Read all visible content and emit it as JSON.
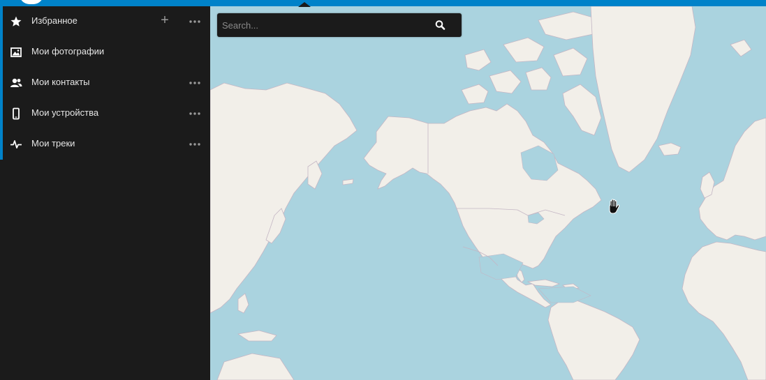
{
  "sidebar": {
    "items": [
      {
        "label": "Избранное",
        "icon": "star-icon",
        "has_add": true,
        "has_menu": true
      },
      {
        "label": "Мои фотографии",
        "icon": "image-icon",
        "has_add": false,
        "has_menu": false
      },
      {
        "label": "Мои контакты",
        "icon": "contacts-icon",
        "has_add": false,
        "has_menu": true
      },
      {
        "label": "Мои устройства",
        "icon": "phone-icon",
        "has_add": false,
        "has_menu": true
      },
      {
        "label": "Мои треки",
        "icon": "activity-icon",
        "has_add": false,
        "has_menu": true
      }
    ],
    "add_symbol": "+"
  },
  "search": {
    "placeholder": "Search...",
    "value": "",
    "icon": "search-icon"
  },
  "cursor": {
    "icon": "hand-grab-cursor-icon"
  },
  "colors": {
    "accent": "#0082c9",
    "sidebar_bg": "#1b1b1b",
    "water": "#aad3df",
    "land": "#f2efe9",
    "border": "#c4b6c4"
  }
}
